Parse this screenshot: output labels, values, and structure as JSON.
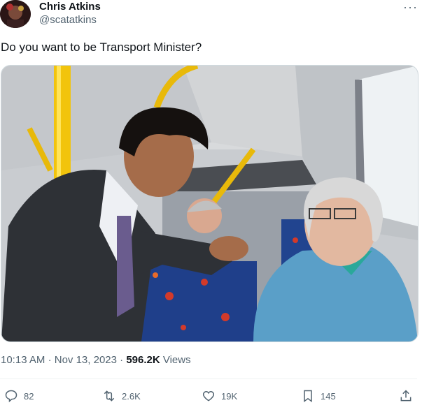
{
  "author": {
    "name": "Chris Atkins",
    "handle": "@scatatkins"
  },
  "tweet": {
    "text": "Do you want to be Transport Minister?",
    "time": "10:13 AM",
    "separator": "·",
    "date": "Nov 13, 2023",
    "views_count": "596.2K",
    "views_label": "Views"
  },
  "actions": {
    "replies": "82",
    "reposts": "2.6K",
    "likes": "19K",
    "bookmarks": "145"
  },
  "icons": {
    "more": "more-icon",
    "reply": "reply-icon",
    "repost": "repost-icon",
    "like": "heart-icon",
    "bookmark": "bookmark-icon",
    "share": "share-icon"
  },
  "colors": {
    "text_primary": "#0f1419",
    "text_secondary": "#536471",
    "pole_yellow": "#f2c40c",
    "seat_blue": "#1f3f8a",
    "jacket_teal": "#5a9fc8"
  }
}
